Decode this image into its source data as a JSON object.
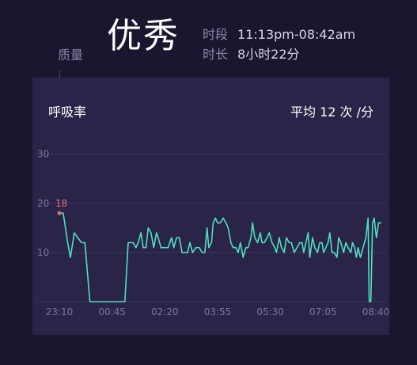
{
  "header": {
    "quality_label": "质量",
    "quality_value": "优秀",
    "period_label": "时段",
    "period_value": "11:13pm-08:42am",
    "duration_label": "时长",
    "duration_value": "8小时22分"
  },
  "card": {
    "title": "呼吸率",
    "average_text": "平均 12 次 /分"
  },
  "colors": {
    "line": "#4fe0c0",
    "annotation": "#e86a6a",
    "grid": "#3c3560",
    "card_bg": "#2a2448",
    "page_bg": "#1b1530"
  },
  "chart_data": {
    "type": "line",
    "title": "",
    "xlabel": "",
    "ylabel": "",
    "ylim": [
      0,
      33
    ],
    "yticks": [
      10,
      20,
      30
    ],
    "xlim": [
      0,
      570
    ],
    "xtick_labels": [
      "23:10",
      "00:45",
      "02:20",
      "03:55",
      "05:30",
      "07:05",
      "08:40"
    ],
    "xtick_values": [
      0,
      95,
      190,
      285,
      380,
      475,
      570
    ],
    "grid": true,
    "annotations": [
      {
        "text": "18",
        "x": 0,
        "y": 18
      }
    ],
    "series": [
      {
        "points": [
          [
            0,
            18
          ],
          [
            7,
            18
          ],
          [
            15,
            12
          ],
          [
            20,
            9
          ],
          [
            27,
            14
          ],
          [
            33,
            13
          ],
          [
            40,
            12
          ],
          [
            46,
            12
          ],
          [
            55,
            0
          ],
          [
            118,
            0
          ],
          [
            124,
            12
          ],
          [
            129,
            12
          ],
          [
            133,
            12
          ],
          [
            138,
            11
          ],
          [
            142,
            12
          ],
          [
            147,
            14
          ],
          [
            151,
            11
          ],
          [
            156,
            11
          ],
          [
            160,
            15
          ],
          [
            165,
            14
          ],
          [
            170,
            11
          ],
          [
            175,
            14
          ],
          [
            178,
            13
          ],
          [
            183,
            11
          ],
          [
            190,
            11
          ],
          [
            196,
            11
          ],
          [
            202,
            13
          ],
          [
            206,
            11
          ],
          [
            211,
            13
          ],
          [
            216,
            13
          ],
          [
            221,
            10
          ],
          [
            226,
            10
          ],
          [
            231,
            10
          ],
          [
            235,
            12
          ],
          [
            240,
            10
          ],
          [
            246,
            11
          ],
          [
            252,
            11
          ],
          [
            257,
            10
          ],
          [
            262,
            10
          ],
          [
            266,
            15
          ],
          [
            269,
            11
          ],
          [
            274,
            12
          ],
          [
            277,
            16
          ],
          [
            281,
            17
          ],
          [
            285,
            16
          ],
          [
            290,
            16
          ],
          [
            295,
            17
          ],
          [
            300,
            16
          ],
          [
            304,
            15
          ],
          [
            309,
            12
          ],
          [
            313,
            11
          ],
          [
            318,
            11
          ],
          [
            322,
            10
          ],
          [
            326,
            12
          ],
          [
            331,
            9
          ],
          [
            336,
            11
          ],
          [
            340,
            11
          ],
          [
            345,
            13
          ],
          [
            348,
            16
          ],
          [
            352,
            13
          ],
          [
            357,
            12
          ],
          [
            362,
            14
          ],
          [
            365,
            12
          ],
          [
            369,
            12
          ],
          [
            374,
            13
          ],
          [
            378,
            14
          ],
          [
            383,
            12
          ],
          [
            388,
            11
          ],
          [
            391,
            10
          ],
          [
            396,
            13
          ],
          [
            400,
            11
          ],
          [
            405,
            10
          ],
          [
            409,
            13
          ],
          [
            414,
            12
          ],
          [
            418,
            12
          ],
          [
            423,
            10
          ],
          [
            428,
            11
          ],
          [
            433,
            12
          ],
          [
            437,
            12
          ],
          [
            440,
            10
          ],
          [
            444,
            12
          ],
          [
            448,
            14
          ],
          [
            451,
            9
          ],
          [
            456,
            13
          ],
          [
            460,
            11
          ],
          [
            465,
            10
          ],
          [
            469,
            12
          ],
          [
            473,
            12
          ],
          [
            476,
            10
          ],
          [
            480,
            11
          ],
          [
            484,
            12
          ],
          [
            487,
            14
          ],
          [
            491,
            10
          ],
          [
            495,
            10
          ],
          [
            500,
            9
          ],
          [
            503,
            13
          ],
          [
            507,
            12
          ],
          [
            512,
            10
          ],
          [
            516,
            12
          ],
          [
            520,
            11
          ],
          [
            525,
            10
          ],
          [
            528,
            12
          ],
          [
            532,
            11
          ],
          [
            535,
            9
          ],
          [
            538,
            11
          ],
          [
            542,
            9
          ],
          [
            547,
            11
          ],
          [
            552,
            13
          ],
          [
            556,
            17
          ],
          [
            558,
            0
          ],
          [
            561,
            0
          ],
          [
            564,
            16
          ],
          [
            567,
            17
          ],
          [
            571,
            13
          ],
          [
            575,
            16
          ],
          [
            580,
            16
          ]
        ]
      }
    ]
  }
}
